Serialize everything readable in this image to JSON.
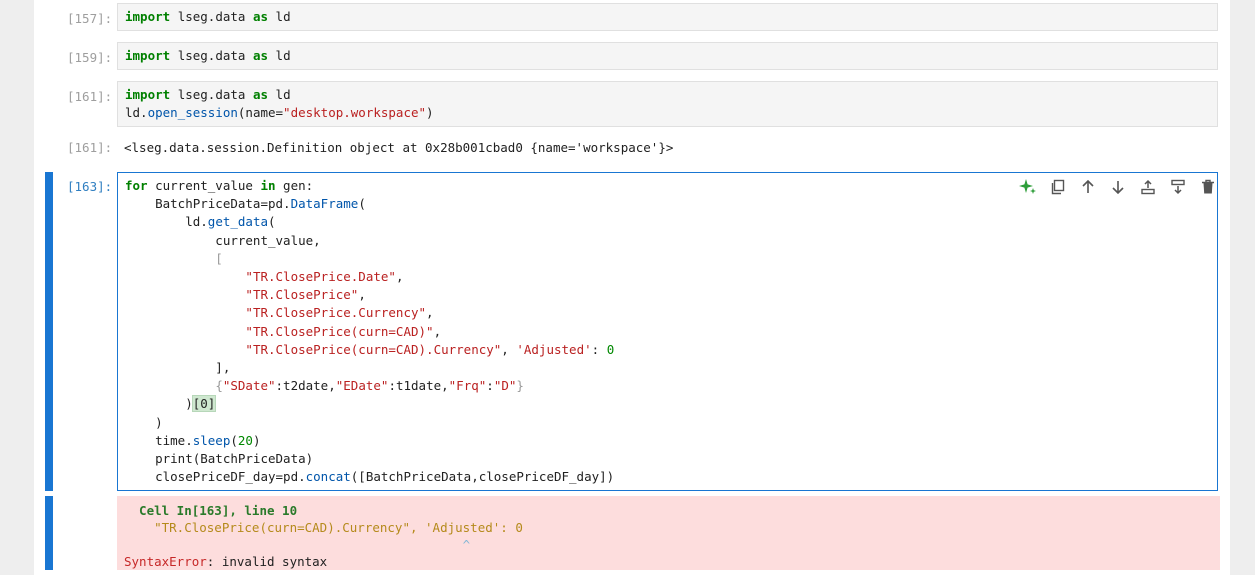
{
  "cells": [
    {
      "prompt": "[157]:",
      "line1": {
        "kw": "import",
        "mod": "lseg.data",
        "as": "as",
        "alias": "ld"
      }
    },
    {
      "prompt": "[159]:",
      "line1": {
        "kw": "import",
        "mod": "lseg.data",
        "as": "as",
        "alias": "ld"
      }
    },
    {
      "prompt": "[161]:",
      "line1": {
        "kw": "import",
        "mod": "lseg.data",
        "as": "as",
        "alias": "ld"
      },
      "line2": {
        "obj": "ld.",
        "fn": "open_session",
        "args_pre": "(name=",
        "arg_str": "\"desktop.workspace\"",
        "args_post": ")"
      }
    }
  ],
  "output161": {
    "prompt": "[161]:",
    "text": "<lseg.data.session.Definition object at 0x28b001cbad0 {name='workspace'}>"
  },
  "active_cell": {
    "prompt": "[163]:",
    "code": {
      "l1_kw1": "for",
      "l1_var": " current_value ",
      "l1_kw2": "in",
      "l1_rest": " gen:",
      "l2_pre": "    BatchPriceData=pd.",
      "l2_fn": "DataFrame",
      "l2_post": "(",
      "l3_pre": "        ld.",
      "l3_fn": "get_data",
      "l3_post": "(",
      "l4": "            current_value,",
      "l5": "            [",
      "s1": "\"TR.ClosePrice.Date\"",
      "s2": "\"TR.ClosePrice\"",
      "s3": "\"TR.ClosePrice.Currency\"",
      "s4": "\"TR.ClosePrice(curn=CAD)\"",
      "s5": "\"TR.ClosePrice(curn=CAD).Currency\"",
      "s5_key": "'Adjusted'",
      "s5_colon": ": ",
      "s5_num": "0",
      "l11": "            ],",
      "d_k1": "\"SDate\"",
      "d_v1": ":t2date,",
      "d_k2": "\"EDate\"",
      "d_v2": ":t1date,",
      "d_k3": "\"Frq\"",
      "d_colon": ":",
      "d_v3": "\"D\"",
      "l13_pre": "        )",
      "l13_brk": "[0]",
      "l14": "    )",
      "l15_pre": "    time.",
      "l15_fn": "sleep",
      "l15_p1": "(",
      "l15_num": "20",
      "l15_p2": ")",
      "l16": "    print(BatchPriceData)",
      "l17_pre": "    closePriceDF_day=pd.",
      "l17_fn": "concat",
      "l17_post": "([BatchPriceData,closePriceDF_day])"
    }
  },
  "toolbar": [
    "ai-sparkle-icon",
    "duplicate-icon",
    "move-up-icon",
    "move-down-icon",
    "insert-above-icon",
    "insert-below-icon",
    "delete-icon"
  ],
  "error": {
    "head": "  Cell In[163], line 10",
    "line": "    \"TR.ClosePrice(curn=CAD).Currency\", 'Adjusted': 0",
    "caret": "                                             ^",
    "type": "SyntaxError",
    "msg": ": invalid syntax"
  },
  "colors": {
    "accent": "#1976d2",
    "error_bg": "#fddddd"
  }
}
